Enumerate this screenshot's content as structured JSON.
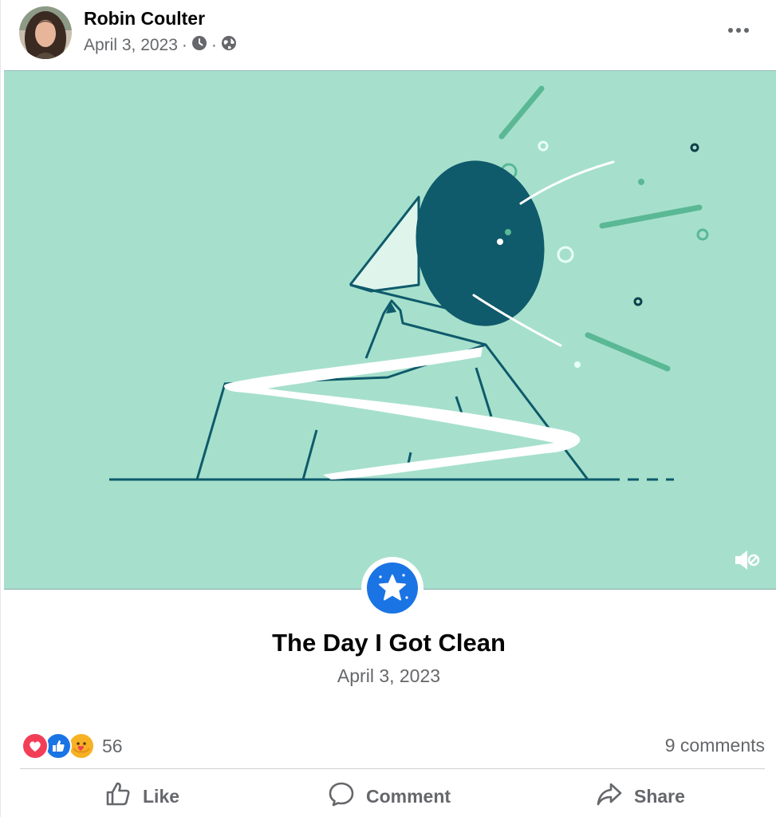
{
  "post": {
    "author": "Robin Coulter",
    "date": "April 3, 2023",
    "separator_1": "·",
    "separator_2": "·"
  },
  "icons": {
    "privacy": "clock-icon",
    "audience": "globe-icon",
    "more": "more-options-icon",
    "mute": "speaker-muted-icon",
    "milestone": "star-icon"
  },
  "milestone": {
    "title": "The Day I Got Clean",
    "date": "April 3, 2023"
  },
  "engagement": {
    "reaction_count": "56",
    "comments": "9 comments",
    "reaction_types": [
      "love",
      "like",
      "care"
    ]
  },
  "actions": {
    "like": "Like",
    "comment": "Comment",
    "share": "Share"
  },
  "colors": {
    "media_background": "#a6e0cc",
    "illustration_dark": "#0f5a6b",
    "accent": "#1b74e4",
    "love": "#f33e58",
    "text_secondary": "#65676b"
  }
}
